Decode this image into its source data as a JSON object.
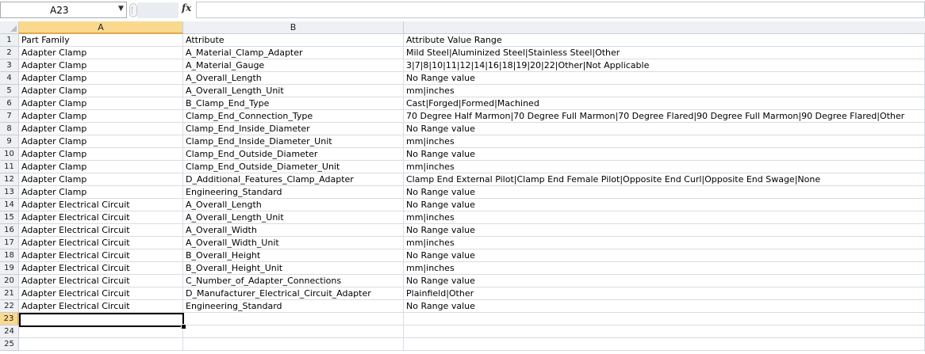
{
  "formula_bar": {
    "name_box": "A23",
    "fx_label": "fx",
    "formula": ""
  },
  "columns": [
    "A",
    "B"
  ],
  "rows": [
    {
      "n": "1",
      "a": "Part Family",
      "b": "Attribute",
      "c": "Attribute Value Range"
    },
    {
      "n": "2",
      "a": "Adapter Clamp",
      "b": "A_Material_Clamp_Adapter",
      "c": "Mild Steel|Aluminized Steel|Stainless Steel|Other"
    },
    {
      "n": "3",
      "a": "Adapter Clamp",
      "b": "A_Material_Gauge",
      "c": "3|7|8|10|11|12|14|16|18|19|20|22|Other|Not Applicable"
    },
    {
      "n": "4",
      "a": "Adapter Clamp",
      "b": "A_Overall_Length",
      "c": "No Range value"
    },
    {
      "n": "5",
      "a": "Adapter Clamp",
      "b": "A_Overall_Length_Unit",
      "c": "mm|inches"
    },
    {
      "n": "6",
      "a": "Adapter Clamp",
      "b": "B_Clamp_End_Type",
      "c": "Cast|Forged|Formed|Machined"
    },
    {
      "n": "7",
      "a": "Adapter Clamp",
      "b": "Clamp_End_Connection_Type",
      "c": "70 Degree Half Marmon|70 Degree Full Marmon|70 Degree Flared|90 Degree Full Marmon|90 Degree Flared|Other"
    },
    {
      "n": "8",
      "a": "Adapter Clamp",
      "b": "Clamp_End_Inside_Diameter",
      "c": "No Range value"
    },
    {
      "n": "9",
      "a": "Adapter Clamp",
      "b": "Clamp_End_Inside_Diameter_Unit",
      "c": "mm|inches"
    },
    {
      "n": "10",
      "a": "Adapter Clamp",
      "b": "Clamp_End_Outside_Diameter",
      "c": "No Range value"
    },
    {
      "n": "11",
      "a": "Adapter Clamp",
      "b": "Clamp_End_Outside_Diameter_Unit",
      "c": "mm|inches"
    },
    {
      "n": "12",
      "a": "Adapter Clamp",
      "b": "D_Additional_Features_Clamp_Adapter",
      "c": "Clamp End External Pilot|Clamp End Female Pilot|Opposite End Curl|Opposite End Swage|None"
    },
    {
      "n": "13",
      "a": "Adapter Clamp",
      "b": "Engineering_Standard",
      "c": "No Range value"
    },
    {
      "n": "14",
      "a": "Adapter Electrical Circuit",
      "b": "A_Overall_Length",
      "c": "No Range value"
    },
    {
      "n": "15",
      "a": "Adapter Electrical Circuit",
      "b": "A_Overall_Length_Unit",
      "c": "mm|inches"
    },
    {
      "n": "16",
      "a": "Adapter Electrical Circuit",
      "b": "A_Overall_Width",
      "c": "No Range value"
    },
    {
      "n": "17",
      "a": "Adapter Electrical Circuit",
      "b": "A_Overall_Width_Unit",
      "c": "mm|inches"
    },
    {
      "n": "18",
      "a": "Adapter Electrical Circuit",
      "b": "B_Overall_Height",
      "c": "No Range value"
    },
    {
      "n": "19",
      "a": "Adapter Electrical Circuit",
      "b": "B_Overall_Height_Unit",
      "c": "mm|inches"
    },
    {
      "n": "20",
      "a": "Adapter Electrical Circuit",
      "b": "C_Number_of_Adapter_Connections",
      "c": "No Range value"
    },
    {
      "n": "21",
      "a": "Adapter Electrical Circuit",
      "b": "D_Manufacturer_Electrical_Circuit_Adapter",
      "c": "Plainfield|Other"
    },
    {
      "n": "22",
      "a": "Adapter Electrical Circuit",
      "b": "Engineering_Standard",
      "c": "No Range value"
    },
    {
      "n": "23",
      "a": "",
      "b": "",
      "c": ""
    },
    {
      "n": "24",
      "a": "",
      "b": "",
      "c": ""
    },
    {
      "n": "25",
      "a": "",
      "b": "",
      "c": ""
    }
  ]
}
